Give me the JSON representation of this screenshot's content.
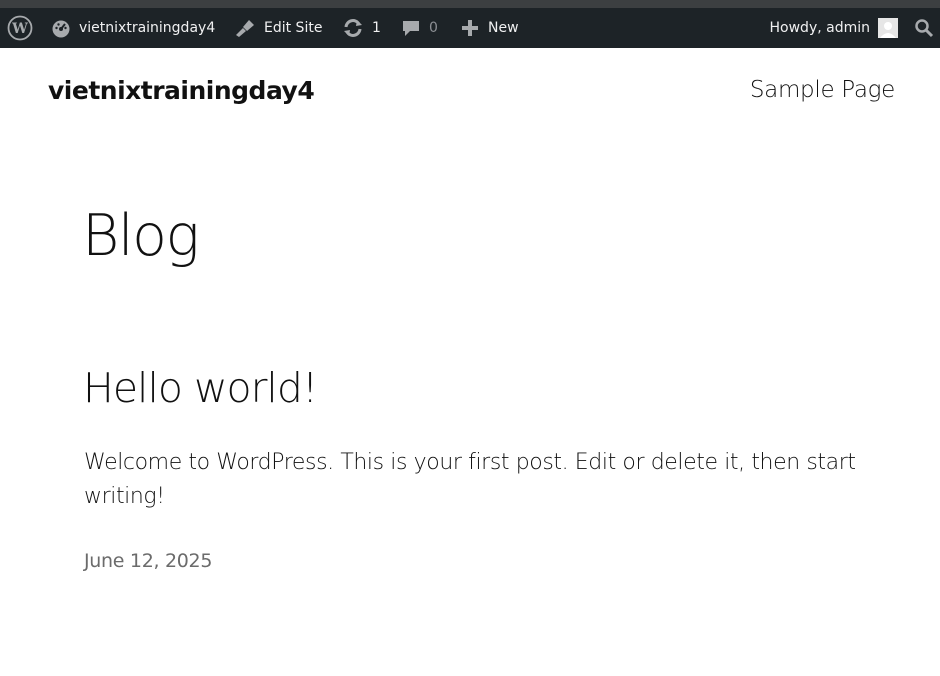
{
  "admin_bar": {
    "wp_logo_icon": "wordpress-logo-icon",
    "site_name": "vietnixtrainingday4",
    "site_icon": "dashboard-gauge-icon",
    "edit_site_label": "Edit Site",
    "edit_site_icon": "brush-icon",
    "updates_count": "1",
    "updates_icon": "refresh-icon",
    "comments_count": "0",
    "comments_icon": "comment-bubble-icon",
    "new_label": "New",
    "new_icon": "plus-icon",
    "howdy_label": "Howdy, admin",
    "search_icon": "search-icon",
    "colors": {
      "bar_bg": "#1d2327",
      "bar_text": "#f0f0f1",
      "muted": "#8c8f94"
    }
  },
  "site_header": {
    "title": "vietnixtrainingday4",
    "nav_items": [
      {
        "label": "Sample Page"
      }
    ]
  },
  "main": {
    "page_title": "Blog",
    "posts": [
      {
        "title": "Hello world!",
        "excerpt": "Welcome to WordPress. This is your first post. Edit or delete it, then start writing!",
        "date": "June 12, 2025"
      }
    ]
  }
}
